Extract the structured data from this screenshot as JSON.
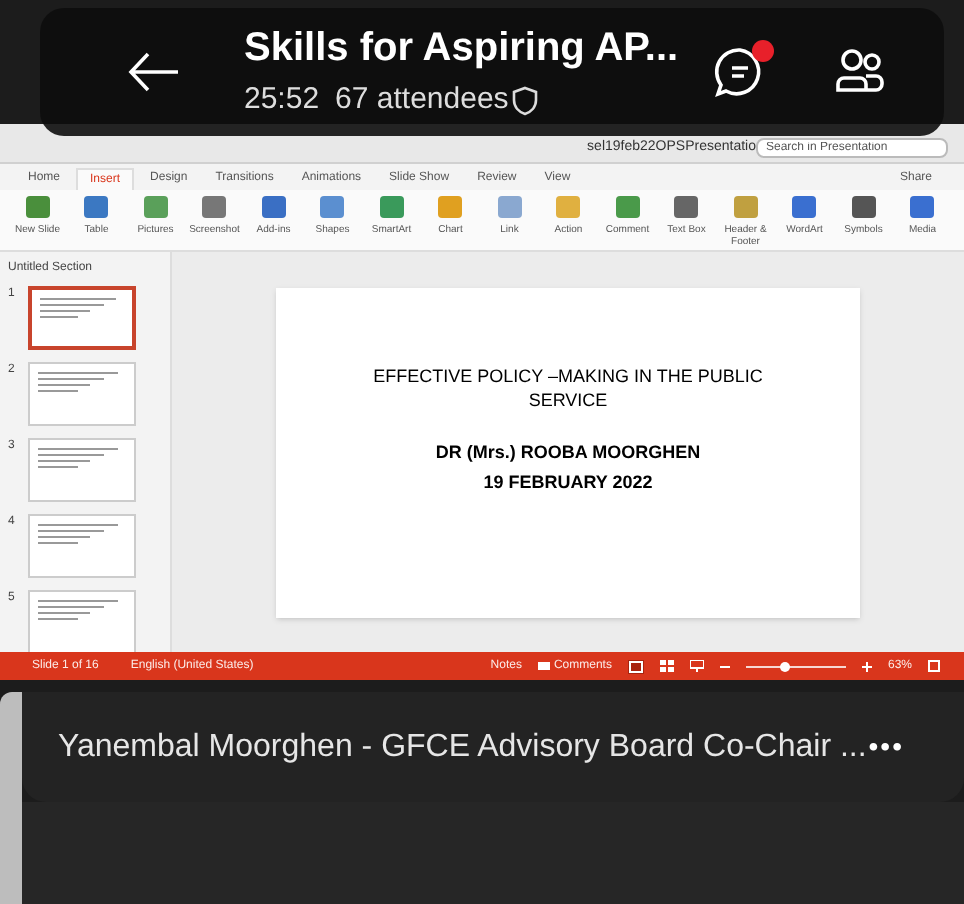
{
  "header": {
    "title": "Skills for Aspiring AP...",
    "duration": "25:52",
    "attendees": "67 attendees",
    "chat_unread": true
  },
  "presentation": {
    "file_name": "sel19feb22OPSPresentatio",
    "search": {
      "placeholder": "Search in Presentation"
    },
    "tabs": [
      {
        "label": "Home",
        "selected": false
      },
      {
        "label": "Insert",
        "selected": true
      },
      {
        "label": "Design",
        "selected": false
      },
      {
        "label": "Transitions",
        "selected": false
      },
      {
        "label": "Animations",
        "selected": false
      },
      {
        "label": "Slide Show",
        "selected": false
      },
      {
        "label": "Review",
        "selected": false
      },
      {
        "label": "View",
        "selected": false
      }
    ],
    "share": "Share",
    "ribbon": [
      "New Slide",
      "Table",
      "Pictures",
      "Screenshot",
      "Add-ins",
      "Shapes",
      "SmartArt",
      "Chart",
      "Link",
      "Action",
      "Comment",
      "Text Box",
      "Header & Footer",
      "WordArt",
      "Symbols",
      "Media"
    ],
    "section": "Untitled Section",
    "thumbnails": [
      {
        "number": "1",
        "selected": true
      },
      {
        "number": "2",
        "selected": false
      },
      {
        "number": "3",
        "selected": false
      },
      {
        "number": "4",
        "selected": false
      },
      {
        "number": "5",
        "selected": false
      }
    ],
    "slide": {
      "title": "EFFECTIVE POLICY –MAKING  IN THE PUBLIC SERVICE",
      "author": "DR  (Mrs.) ROOBA MOORGHEN",
      "date": "19 FEBRUARY 2022"
    },
    "status_bar": {
      "slide": "Slide 1 of 16",
      "language": "English (United States)",
      "notes": "Notes",
      "comments": "Comments",
      "zoom": {
        "level": 0.4
      },
      "zoom_percent": "63%"
    }
  },
  "participant": {
    "name": "Yanembal Moorghen - GFCE Advisory Board Co-Chair ...",
    "more": "•••"
  }
}
